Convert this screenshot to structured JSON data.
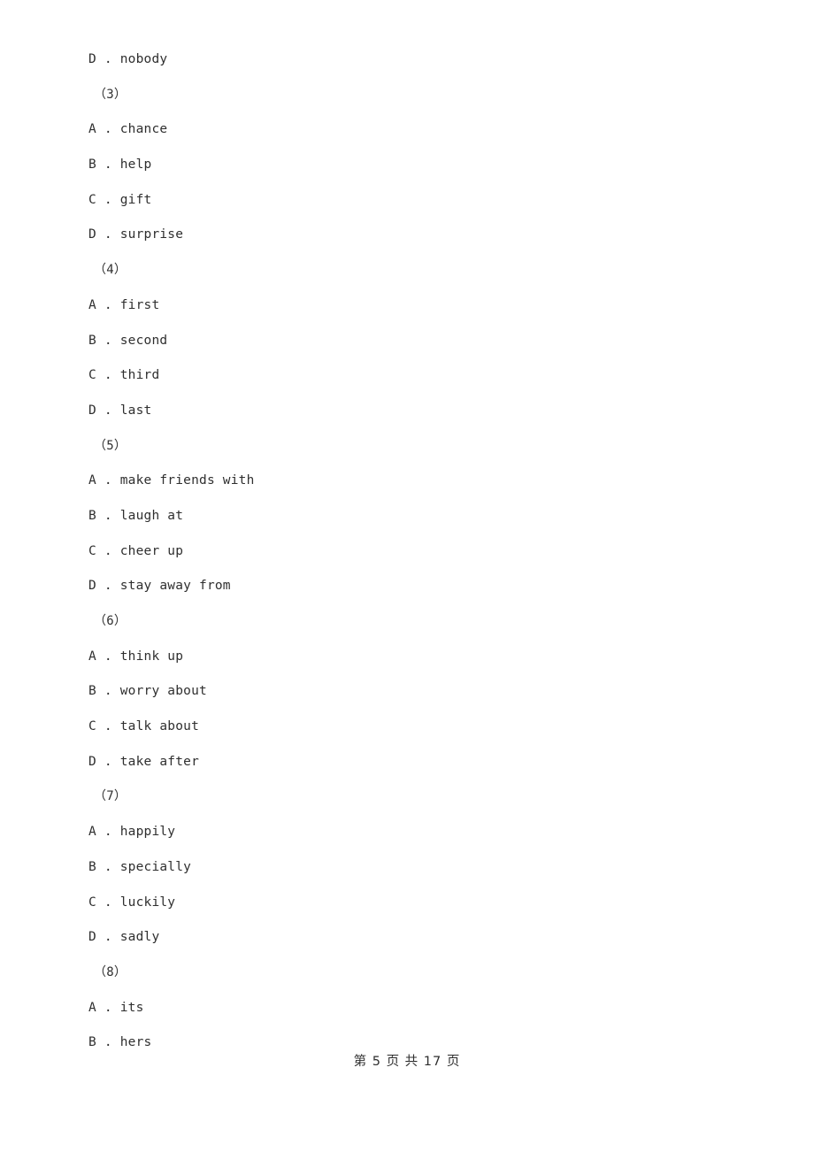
{
  "document": {
    "page_label": "第 5 页 共 17 页",
    "page_number": "5",
    "total_pages": "17",
    "text_color": "#2f2f2f",
    "background_color": "#ffffff"
  },
  "lines": [
    {
      "id": "l0",
      "kind": "option",
      "text": "D . nobody"
    },
    {
      "id": "l1",
      "kind": "question",
      "text": "（3）"
    },
    {
      "id": "l2",
      "kind": "option",
      "text": "A . chance"
    },
    {
      "id": "l3",
      "kind": "option",
      "text": "B . help"
    },
    {
      "id": "l4",
      "kind": "option",
      "text": "C . gift"
    },
    {
      "id": "l5",
      "kind": "option",
      "text": "D . surprise"
    },
    {
      "id": "l6",
      "kind": "question",
      "text": "（4）"
    },
    {
      "id": "l7",
      "kind": "option",
      "text": "A . first"
    },
    {
      "id": "l8",
      "kind": "option",
      "text": "B . second"
    },
    {
      "id": "l9",
      "kind": "option",
      "text": "C . third"
    },
    {
      "id": "l10",
      "kind": "option",
      "text": "D . last"
    },
    {
      "id": "l11",
      "kind": "question",
      "text": "（5）"
    },
    {
      "id": "l12",
      "kind": "option",
      "text": "A . make friends with"
    },
    {
      "id": "l13",
      "kind": "option",
      "text": "B . laugh at"
    },
    {
      "id": "l14",
      "kind": "option",
      "text": "C . cheer up"
    },
    {
      "id": "l15",
      "kind": "option",
      "text": "D . stay away from"
    },
    {
      "id": "l16",
      "kind": "question",
      "text": "（6）"
    },
    {
      "id": "l17",
      "kind": "option",
      "text": "A . think up"
    },
    {
      "id": "l18",
      "kind": "option",
      "text": "B . worry about"
    },
    {
      "id": "l19",
      "kind": "option",
      "text": "C . talk about"
    },
    {
      "id": "l20",
      "kind": "option",
      "text": "D . take after"
    },
    {
      "id": "l21",
      "kind": "question",
      "text": "（7）"
    },
    {
      "id": "l22",
      "kind": "option",
      "text": "A . happily"
    },
    {
      "id": "l23",
      "kind": "option",
      "text": "B . specially"
    },
    {
      "id": "l24",
      "kind": "option",
      "text": "C . luckily"
    },
    {
      "id": "l25",
      "kind": "option",
      "text": "D . sadly"
    },
    {
      "id": "l26",
      "kind": "question",
      "text": "（8）"
    },
    {
      "id": "l27",
      "kind": "option",
      "text": "A . its"
    },
    {
      "id": "l28",
      "kind": "option",
      "text": "B . hers"
    }
  ]
}
